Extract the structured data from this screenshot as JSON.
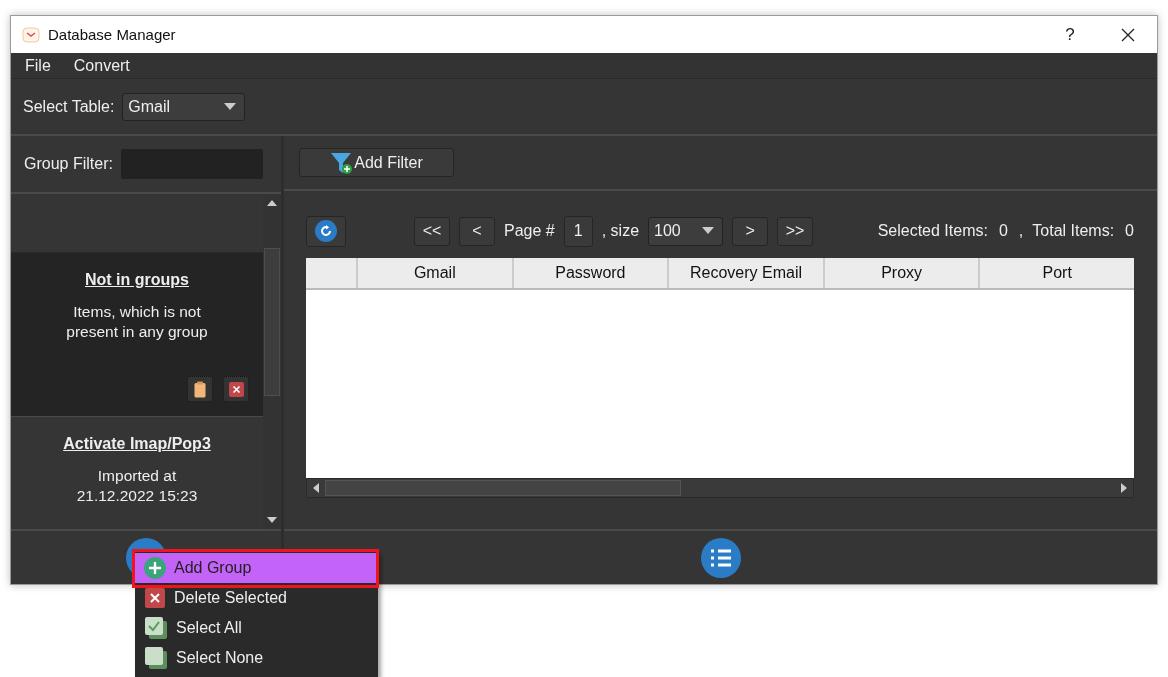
{
  "window": {
    "title": "Database Manager",
    "help": "?"
  },
  "menu_bar": [
    "File",
    "Convert"
  ],
  "select_table": {
    "label": "Select Table:",
    "value": "Gmail"
  },
  "group_filter": {
    "label": "Group Filter:"
  },
  "groups": [
    {
      "title": "Not in groups",
      "description": "Items, which is not present in any group",
      "selected": true
    },
    {
      "title": "Activate Imap/Pop3",
      "description": "Imported at 21.12.2022 15:23",
      "selected": false
    }
  ],
  "add_filter": "Add Filter",
  "pager": {
    "first": "<<",
    "prev": "<",
    "page_label": "Page #",
    "page": "1",
    "size_label": ", size",
    "size": "100",
    "next": ">",
    "last": ">>"
  },
  "counts": {
    "selected_label": "Selected Items:",
    "selected": "0",
    "separator": ",",
    "total_label": "Total Items:",
    "total": "0"
  },
  "table": {
    "columns": [
      "Gmail",
      "Password",
      "Recovery Email",
      "Proxy",
      "Port"
    ]
  },
  "context_menu": [
    {
      "kind": "add",
      "label": "Add Group",
      "selected": true,
      "outlined": true
    },
    {
      "kind": "delete",
      "label": "Delete Selected",
      "selected": false,
      "outlined": false
    },
    {
      "kind": "check",
      "label": "Select All",
      "selected": false,
      "outlined": false
    },
    {
      "kind": "uncheck",
      "label": "Select None",
      "selected": false,
      "outlined": false
    }
  ]
}
